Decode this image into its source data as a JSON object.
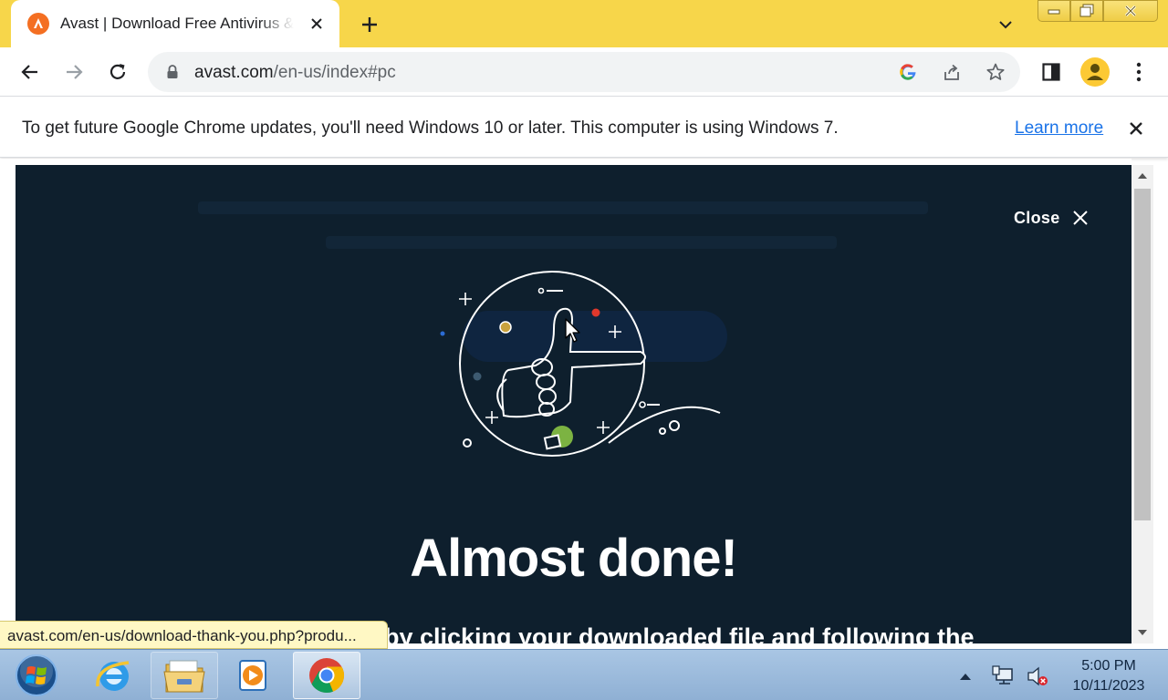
{
  "browser": {
    "tab_title": "Avast | Download Free Antivirus & VPN",
    "url_host": "avast.com",
    "url_path": "/en-us/index#pc"
  },
  "infobar": {
    "message": "To get future Google Chrome updates, you'll need Windows 10 or later. This computer is using Windows 7.",
    "learn_more": "Learn more"
  },
  "modal": {
    "close_label": "Close",
    "headline": "Almost done!",
    "subline": "o by clicking your downloaded file and following the"
  },
  "status_bar": {
    "link_url": "avast.com/en-us/download-thank-you.php?produ..."
  },
  "taskbar": {
    "apps": [
      "start-orb",
      "internet-explorer",
      "file-explorer",
      "media-player",
      "google-chrome"
    ],
    "time": "5:00 PM",
    "date": "10/11/2023"
  },
  "colors": {
    "tab_strip": "#f7d64a",
    "modal_bg": "#0e1f2d",
    "link_blue": "#1a73e8",
    "avast_orange": "#f46f22"
  }
}
